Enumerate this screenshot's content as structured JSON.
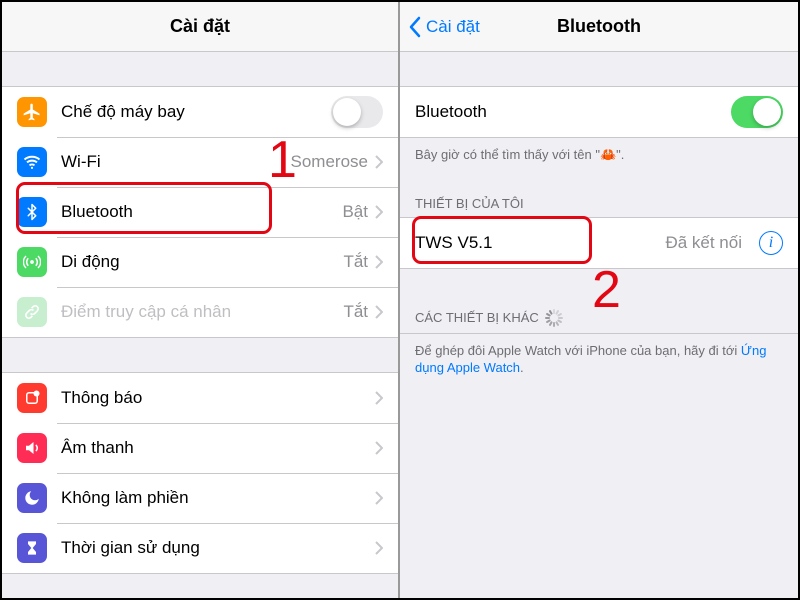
{
  "left": {
    "title": "Cài đặt",
    "groups": [
      {
        "items": [
          {
            "key": "airplane",
            "icon": "airplane",
            "color": "#ff9500",
            "label": "Chế độ máy bay",
            "control": "toggle",
            "state": "off"
          },
          {
            "key": "wifi",
            "icon": "wifi",
            "color": "#007aff",
            "label": "Wi-Fi",
            "value": "Somerose"
          },
          {
            "key": "bluetooth",
            "icon": "bluetooth",
            "color": "#007aff",
            "label": "Bluetooth",
            "value": "Bật"
          },
          {
            "key": "cellular",
            "icon": "cellular",
            "color": "#4cd964",
            "label": "Di động",
            "value": "Tắt"
          },
          {
            "key": "hotspot",
            "icon": "link",
            "color": "#c6eecf",
            "label": "Điểm truy cập cá nhân",
            "value": "Tắt",
            "dim": true
          }
        ]
      },
      {
        "items": [
          {
            "key": "notifications",
            "icon": "notify",
            "color": "#ff3b30",
            "label": "Thông báo"
          },
          {
            "key": "sounds",
            "icon": "sound",
            "color": "#ff2d55",
            "label": "Âm thanh"
          },
          {
            "key": "dnd",
            "icon": "moon",
            "color": "#5856d6",
            "label": "Không làm phiền"
          },
          {
            "key": "screentime",
            "icon": "hourglass",
            "color": "#5856d6",
            "label": "Thời gian sử dụng"
          }
        ]
      }
    ]
  },
  "right": {
    "back": "Cài đặt",
    "title": "Bluetooth",
    "switch_label": "Bluetooth",
    "switch_state": "on",
    "discoverable_note": "Bây giờ có thể tìm thấy với tên \"🦀\".",
    "my_devices_header": "THIẾT BỊ CỦA TÔI",
    "device_name": "TWS V5.1",
    "device_status": "Đã kết nối",
    "other_devices_header": "CÁC THIẾT BỊ KHÁC",
    "pairing_note": "Để ghép đôi Apple Watch với iPhone của bạn, hãy đi tới ",
    "pairing_link": "Ứng dụng Apple Watch"
  },
  "annotations": {
    "one": "1",
    "two": "2"
  }
}
